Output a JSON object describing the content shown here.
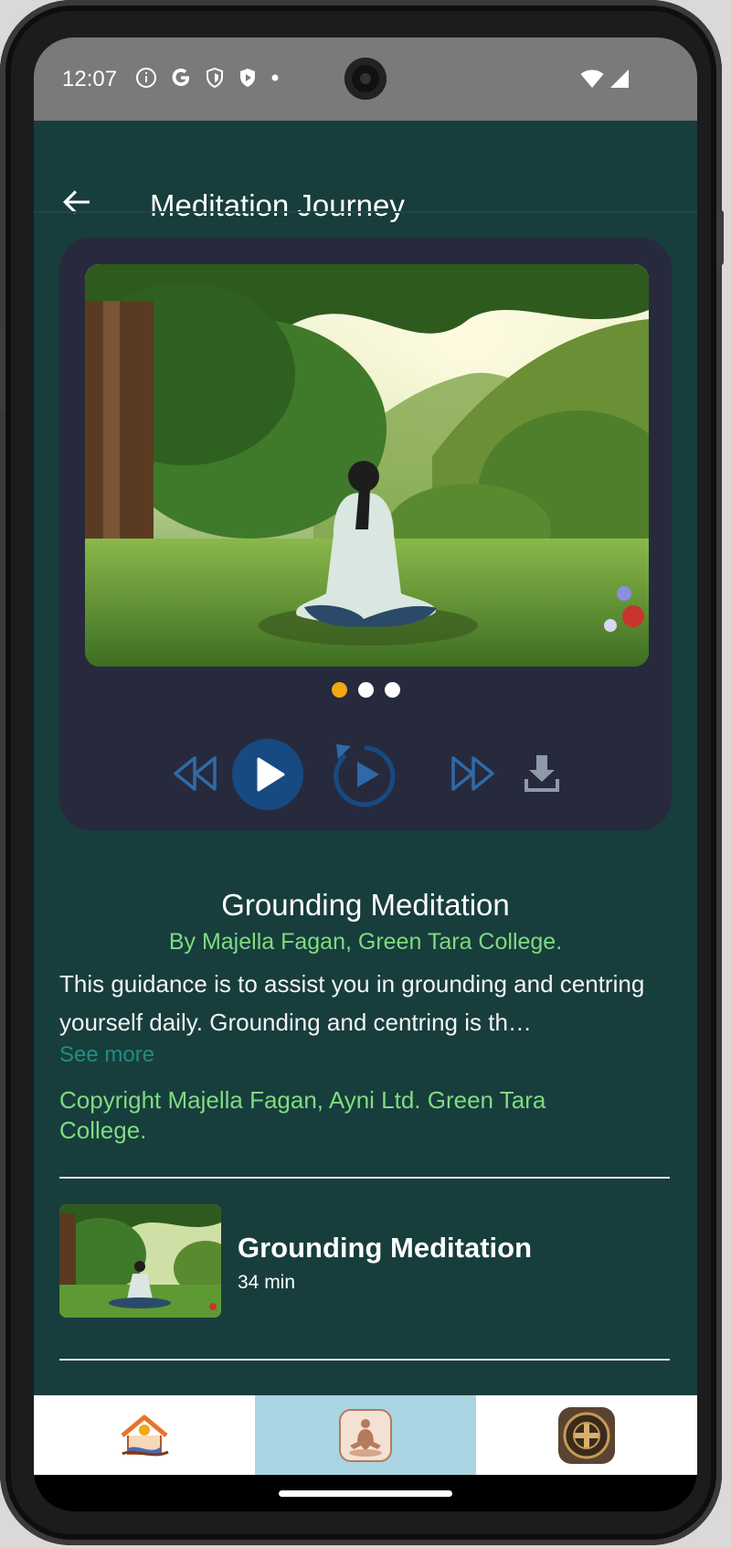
{
  "status_bar": {
    "time": "12:07",
    "icons": [
      "info-icon",
      "google-icon",
      "shield-icon",
      "play-protect-icon",
      "dot-icon"
    ],
    "right_icons": [
      "wifi-icon",
      "cellular-signal-icon"
    ]
  },
  "app_bar": {
    "title": "Meditation Journey",
    "back_icon": "arrow-back-icon"
  },
  "player": {
    "artwork_description_icon": "meditation-forest-artwork",
    "pager_dots": 3,
    "active_dot": 0,
    "controls": [
      "rewind-icon",
      "play-icon",
      "replay-icon",
      "fast-forward-icon",
      "download-icon"
    ]
  },
  "track": {
    "title": "Grounding Meditation",
    "author": "By Majella Fagan, Green Tara College.",
    "description": "This guidance is to assist you in grounding and centring yourself daily. Grounding and centring is th…",
    "see_more": "See more",
    "copyright": "Copyright Majella Fagan, Ayni Ltd. Green Tara College."
  },
  "playlist": [
    {
      "title": "Grounding Meditation",
      "duration": "34 min"
    }
  ],
  "bottom_nav": {
    "items": [
      "home-icon",
      "meditation-icon",
      "cross-medallion-icon"
    ],
    "active_index": 1
  },
  "colors": {
    "background": "#183d3d",
    "card": "#272a3d",
    "accent_green": "#7fdc7f",
    "see_more": "#1f8f83",
    "dot_active": "#f3a712",
    "control_blue": "#2f6aa8",
    "nav_active": "#a9d4e1"
  }
}
